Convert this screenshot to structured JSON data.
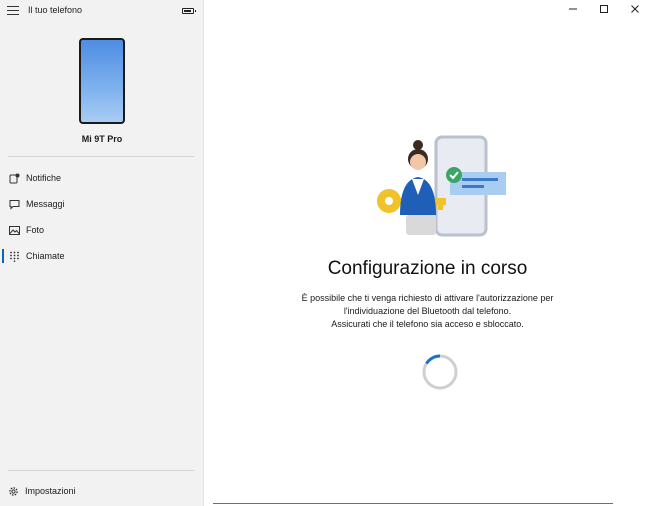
{
  "app": {
    "title": "Il tuo telefono"
  },
  "device": {
    "name": "Mi 9T Pro"
  },
  "sidebar": {
    "items": [
      {
        "label": "Notifiche",
        "icon": "notification-icon"
      },
      {
        "label": "Messaggi",
        "icon": "message-icon"
      },
      {
        "label": "Foto",
        "icon": "photo-icon"
      },
      {
        "label": "Chiamate",
        "icon": "dialpad-icon",
        "active": true
      }
    ],
    "settings_label": "Impostazioni"
  },
  "main": {
    "heading": "Configurazione in corso",
    "description_lines": [
      "È possibile che ti venga richiesto di attivare l'autorizzazione per",
      "l'individuazione del Bluetooth dal telefono.",
      "Assicurati che il telefono sia acceso e sbloccato."
    ]
  },
  "colors": {
    "accent": "#0a64c8",
    "sidebar_bg": "#f2f2f2",
    "phone_screen": "#4f8de3"
  }
}
